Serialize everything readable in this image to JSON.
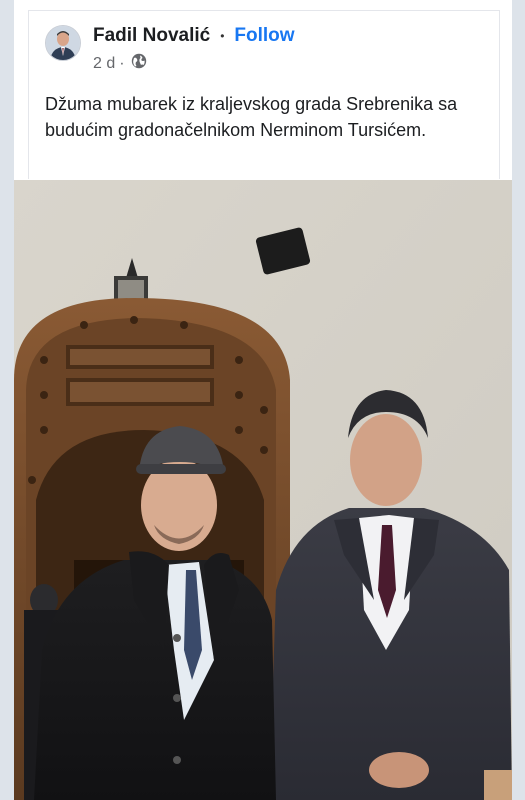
{
  "post": {
    "author": "Fadil Novalić",
    "separator": "•",
    "follow_label": "Follow",
    "time": "2 d",
    "time_separator": "·",
    "visibility_icon": "globe-icon",
    "caption": "Džuma mubarek iz kraljevskog grada Srebrenika sa budućim gradonačelnikom Nerminom Tursićem."
  },
  "colors": {
    "accent": "#1877f2",
    "text": "#1c1e21",
    "secondary_text": "#65676b"
  }
}
